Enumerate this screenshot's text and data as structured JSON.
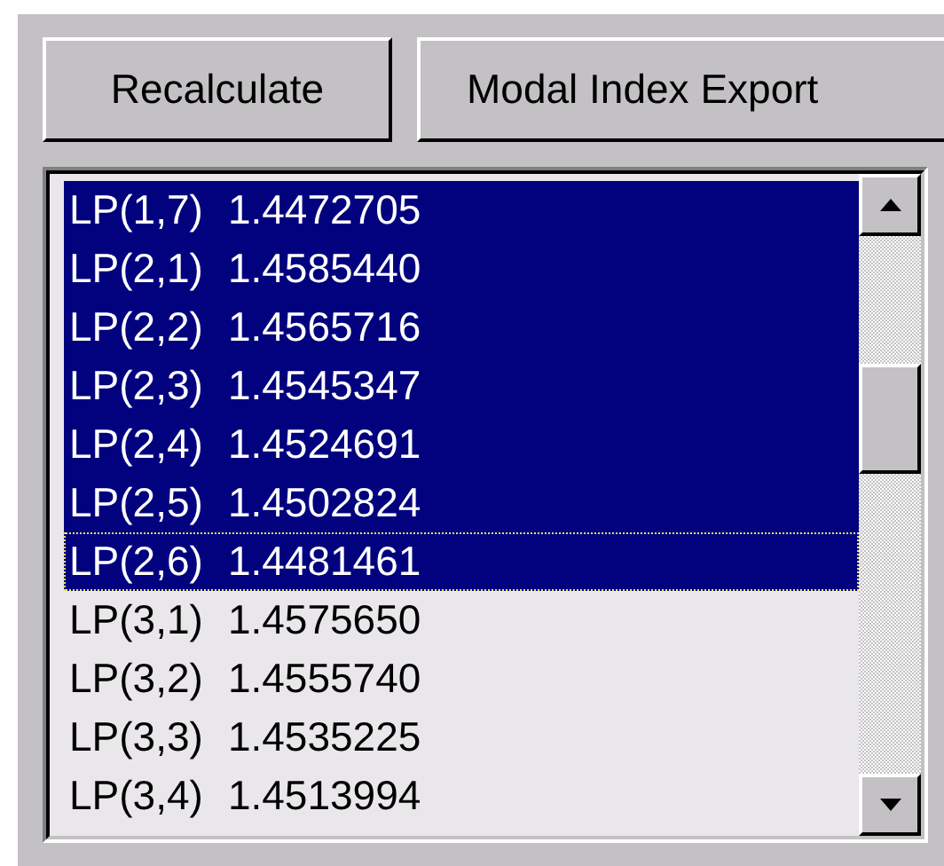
{
  "buttons": [
    "Recalculate",
    "Modal Index Export"
  ],
  "list": {
    "items": [
      {
        "label": "LP(1,7)",
        "value": "1.4472705",
        "selected": true,
        "focused": false
      },
      {
        "label": "LP(2,1)",
        "value": "1.4585440",
        "selected": true,
        "focused": false
      },
      {
        "label": "LP(2,2)",
        "value": "1.4565716",
        "selected": true,
        "focused": false
      },
      {
        "label": "LP(2,3)",
        "value": "1.4545347",
        "selected": true,
        "focused": false
      },
      {
        "label": "LP(2,4)",
        "value": "1.4524691",
        "selected": true,
        "focused": false
      },
      {
        "label": "LP(2,5)",
        "value": "1.4502824",
        "selected": true,
        "focused": false
      },
      {
        "label": "LP(2,6)",
        "value": "1.4481461",
        "selected": true,
        "focused": true
      },
      {
        "label": "LP(3,1)",
        "value": "1.4575650",
        "selected": false,
        "focused": false
      },
      {
        "label": "LP(3,2)",
        "value": "1.4555740",
        "selected": false,
        "focused": false
      },
      {
        "label": "LP(3,3)",
        "value": "1.4535225",
        "selected": false,
        "focused": false
      },
      {
        "label": "LP(3,4)",
        "value": "1.4513994",
        "selected": false,
        "focused": false
      }
    ]
  }
}
